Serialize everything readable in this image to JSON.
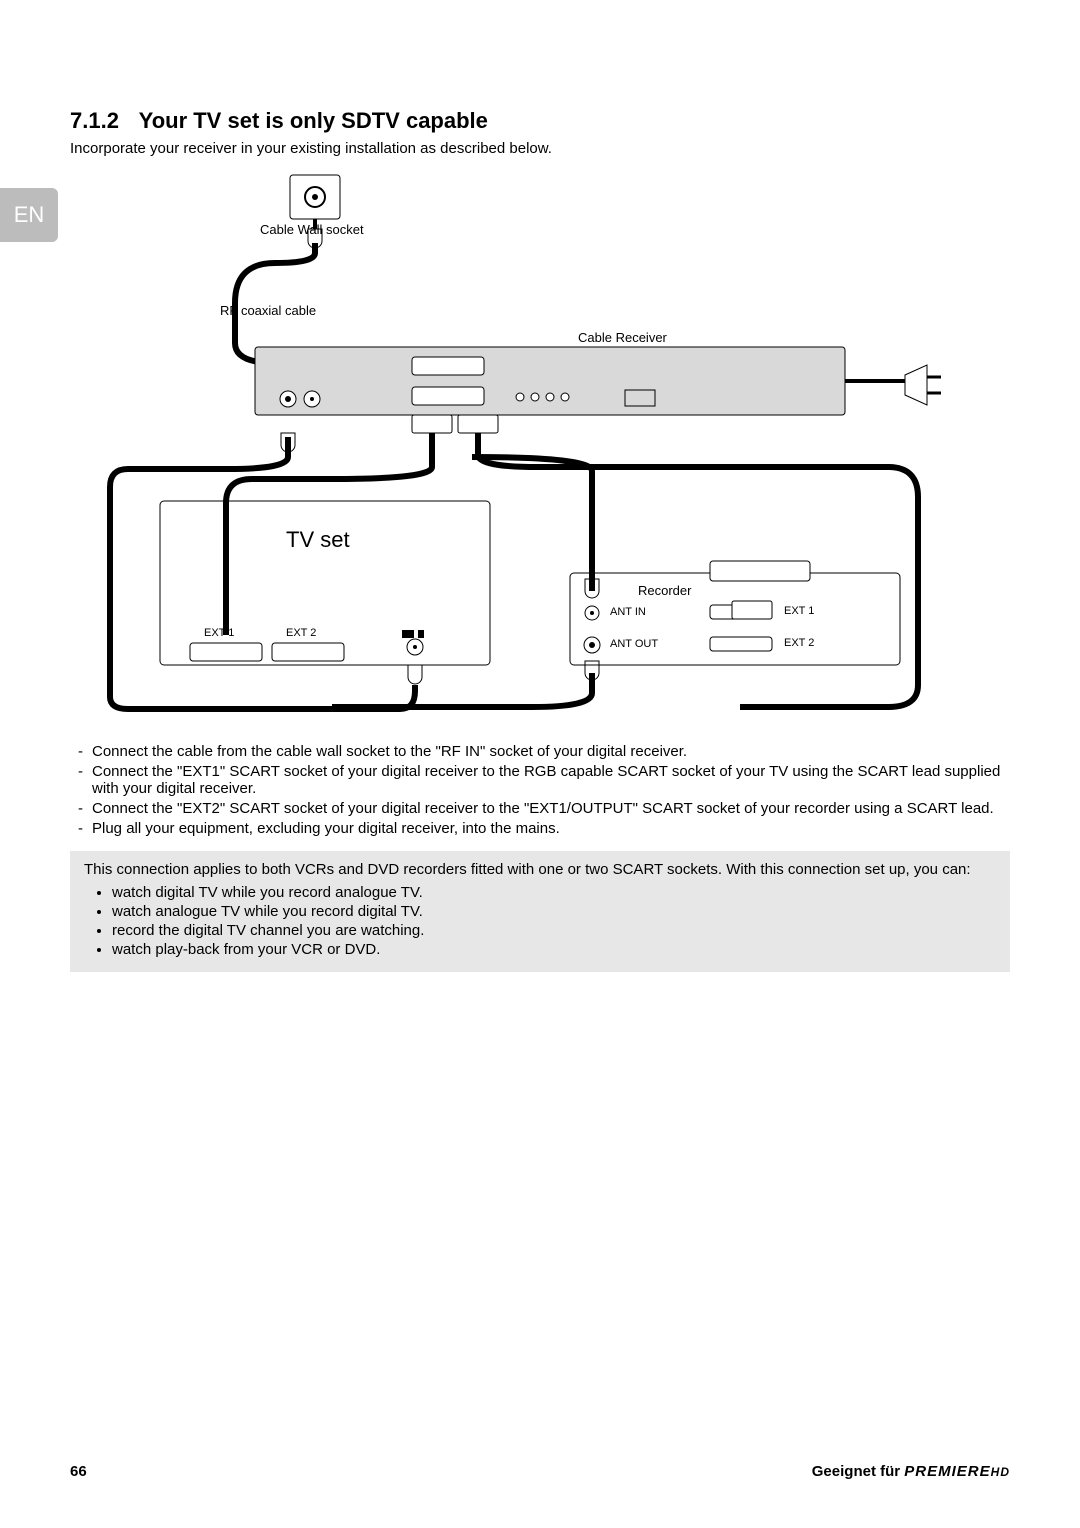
{
  "lang_tab": "EN",
  "section_number": "7.1.2",
  "section_title": "Your TV set is only SDTV capable",
  "intro": "Incorporate your receiver in your existing installation as described below.",
  "diagram": {
    "cable_wall_socket": "Cable Wall socket",
    "rf_coaxial_cable": "RF coaxial cable",
    "cable_receiver": "Cable Receiver",
    "tv_set": "TV set",
    "ext1": "EXT 1",
    "ext2": "EXT 2",
    "recorder": "Recorder",
    "ant_in": "ANT IN",
    "ant_out": "ANT OUT",
    "ext1_r": "EXT 1",
    "ext2_r": "EXT 2"
  },
  "instructions": [
    "Connect the cable from the cable wall socket to the \"RF IN\" socket of your digital receiver.",
    "Connect the \"EXT1\" SCART socket of your digital receiver to the RGB capable SCART socket of your TV using the SCART lead supplied with your digital receiver.",
    "Connect the \"EXT2\" SCART socket of your digital receiver to the \"EXT1/OUTPUT\" SCART socket of your recorder using a SCART lead.",
    "Plug all your equipment, excluding your digital receiver, into the mains."
  ],
  "note_intro": "This connection applies to both VCRs and DVD recorders fitted with one or two SCART sockets. With this connection set up, you can:",
  "note_items": [
    "watch digital TV while you record analogue TV.",
    "watch analogue TV while you record digital TV.",
    "record the digital TV channel you are watching.",
    "watch play-back from your VCR or DVD."
  ],
  "footer": {
    "page_no": "66",
    "suitable_for": "Geeignet für",
    "brand": "PREMIERE",
    "brand_suffix": "HD"
  }
}
